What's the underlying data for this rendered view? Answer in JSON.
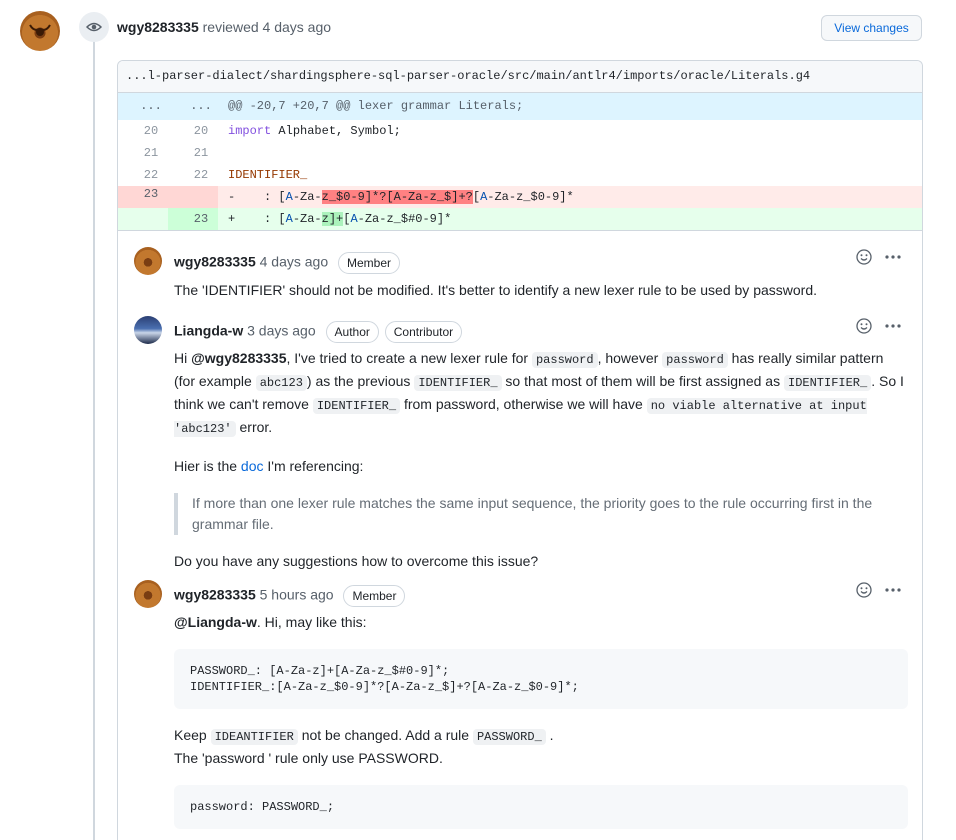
{
  "review": {
    "user": "wgy8283335",
    "action": "reviewed",
    "time": "4 days ago",
    "view_changes_label": "View changes"
  },
  "file": {
    "path": "...l-parser-dialect/shardingsphere-sql-parser-oracle/src/main/antlr4/imports/oracle/Literals.g4",
    "hunk": {
      "n1": "...",
      "n2": "...",
      "text": "@@ -20,7 +20,7 @@ lexer grammar Literals;"
    },
    "lines": {
      "l1": {
        "n1": "20",
        "n2": "20",
        "kw": "import",
        "rest": " Alphabet, Symbol;"
      },
      "l2": {
        "n1": "21",
        "n2": "21"
      },
      "l3": {
        "n1": "22",
        "n2": "22",
        "id": "IDENTIFIER_"
      },
      "del": {
        "n1": "23",
        "sign": "-",
        "p1": "    : [",
        "p2": "A",
        "p3": "-Za-",
        "p4": "z_$0-9]*?[A-Za-z_$]+?",
        "p5": "[",
        "p6": "A",
        "p7": "-Za-z_$0-9]*"
      },
      "add": {
        "n2": "23",
        "sign": "+",
        "p1": "    : [",
        "p2": "A",
        "p3": "-Za-",
        "p4": "z]+",
        "p5": "[",
        "p6": "A",
        "p7": "-Za-z_$#0-9]*"
      }
    }
  },
  "comments": [
    {
      "author": "wgy8283335",
      "time": "4 days ago",
      "roles": [
        "Member"
      ],
      "text": "The 'IDENTIFIER' should not be modified. It's better to identify a new lexer rule to be used by password."
    },
    {
      "author": "Liangda-w",
      "time": "3 days ago",
      "roles": [
        "Author",
        "Contributor"
      ],
      "p1": {
        "a": "Hi ",
        "mention": "@wgy8283335",
        "b": ", I've tried to create a new lexer rule for ",
        "c1": "password",
        "c": ", however ",
        "c2": "password",
        "d": " has really similar pattern (for example ",
        "c3": "abc123",
        "e": ") as the previous ",
        "c4": "IDENTIFIER_",
        "f": " so that most of them will be first assigned as ",
        "c5": "IDENTIFIER_",
        "g": ". So I think we can't remove ",
        "c6": "IDENTIFIER_",
        "h": " from password, otherwise we will have ",
        "c7": "no viable alternative at input 'abc123'",
        "i": " error."
      },
      "p2": {
        "a": "Hier is the ",
        "link": "doc",
        "b": " I'm referencing:"
      },
      "quote": "If more than one lexer rule matches the same input sequence, the priority goes to the rule occurring first in the grammar file.",
      "p3": "Do you have any suggestions how to overcome this issue?"
    },
    {
      "author": "wgy8283335",
      "time": "5 hours ago",
      "roles": [
        "Member"
      ],
      "p1": {
        "mention": "@Liangda-w",
        "a": ". Hi, may like this:"
      },
      "code1": "PASSWORD_: [A-Za-z]+[A-Za-z_$#0-9]*;\nIDENTIFIER_:[A-Za-z_$0-9]*?[A-Za-z_$]+?[A-Za-z_$0-9]*;",
      "p2": {
        "a": "Keep ",
        "c1": "IDEANTIFIER",
        "b": " not be changed. Add a rule ",
        "c2": "PASSWORD_",
        "c": " ."
      },
      "p3": "The 'password ' rule only use PASSWORD.",
      "code2": "password: PASSWORD_;"
    }
  ],
  "icons": {
    "eye": "eye-icon",
    "emoji": "smiley-icon",
    "more": "kebab-horizontal-icon"
  }
}
